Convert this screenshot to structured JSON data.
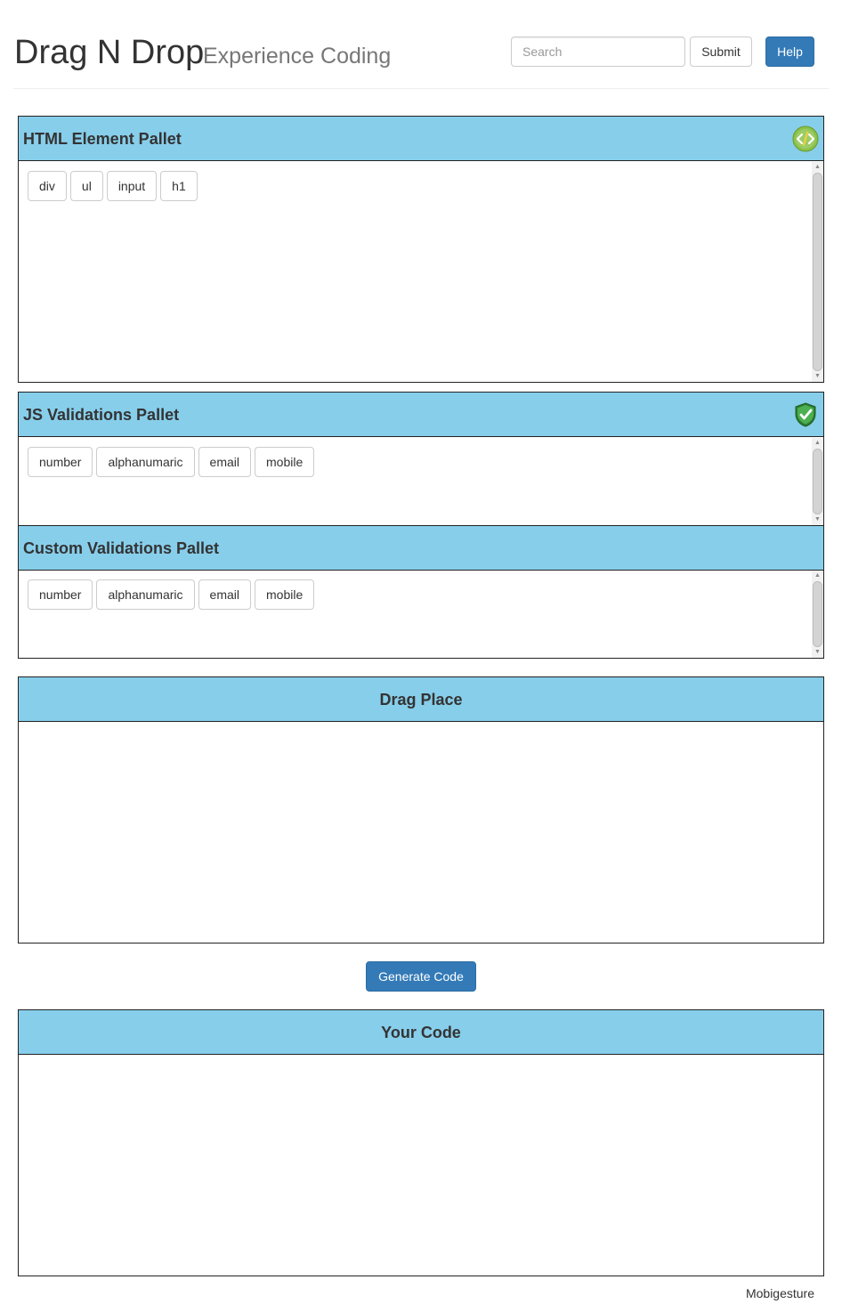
{
  "header": {
    "brand": "Drag N Drop",
    "subtitle": "Experience Coding",
    "search_placeholder": "Search",
    "submit_label": "Submit",
    "help_label": "Help"
  },
  "html_pallet": {
    "title": "HTML Element Pallet",
    "icon": "code-icon",
    "items": [
      "div",
      "ul",
      "input",
      "h1"
    ]
  },
  "js_pallet": {
    "title": "JS Validations Pallet",
    "icon": "shield-check-icon",
    "items": [
      "number",
      "alphanumaric",
      "email",
      "mobile"
    ]
  },
  "custom_pallet": {
    "title": "Custom Validations Pallet",
    "items": [
      "number",
      "alphanumaric",
      "email",
      "mobile"
    ]
  },
  "drag_place": {
    "title": "Drag Place"
  },
  "generate_label": "Generate Code",
  "your_code": {
    "title": "Your Code"
  },
  "footer": {
    "text": "Mobigesture"
  },
  "colors": {
    "panel_header": "#87ceeb",
    "primary": "#337ab7"
  }
}
